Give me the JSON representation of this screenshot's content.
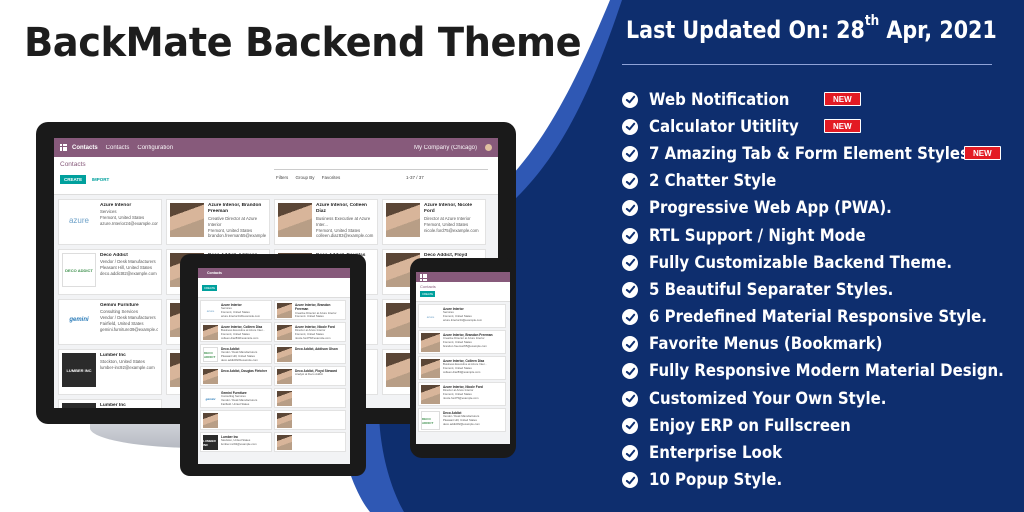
{
  "title": "BackMate Backend Theme",
  "updated": {
    "prefix": "Last Updated On: 28",
    "sup": "th",
    "suffix": " Apr, 2021"
  },
  "colors": {
    "navy": "#0e2e6e",
    "accent_blue": "#2f58b4",
    "badge_red": "#e31b23",
    "odoo_purple": "#875a7b",
    "teal": "#00a09d"
  },
  "features": [
    {
      "text": "Web Notification",
      "badge": "NEW"
    },
    {
      "text": "Calculator Utitlity",
      "badge": "NEW"
    },
    {
      "text": "7 Amazing Tab & Form Element Styles",
      "badge": "NEW"
    },
    {
      "text": "2 Chatter Style"
    },
    {
      "text": "Progressive Web App (PWA)."
    },
    {
      "text": "RTL Support / Night Mode"
    },
    {
      "text": "Fully Customizable Backend Theme."
    },
    {
      "text": "5 Beautiful Separater Styles."
    },
    {
      "text": "6 Predefined Material Responsive Style."
    },
    {
      "text": "Favorite Menus (Bookmark)"
    },
    {
      "text": "Fully Responsive Modern Material Design."
    },
    {
      "text": "Customized Your Own Style."
    },
    {
      "text": "Enjoy ERP on Fullscreen"
    },
    {
      "text": "Enterprise Look"
    },
    {
      "text": "10 Popup Style."
    }
  ],
  "app": {
    "name": "Contacts",
    "menu": [
      "Contacts",
      "Configuration"
    ],
    "company": "My Company (Chicago)",
    "breadcrumb": "Contacts",
    "create": "CREATE",
    "import": "IMPORT",
    "filters": "Filters",
    "group_by": "Group By",
    "favorites": "Favorites",
    "pager": "1-37 / 37",
    "cards": [
      {
        "logo": "azure",
        "logo_text": "azure",
        "name": "Azure Interior",
        "lines": [
          "Services",
          "Fremont, United States",
          "azure.Interior24@example.com"
        ]
      },
      {
        "logo": "photo",
        "logo_text": "",
        "name": "Azure Interior, Brandon Freeman",
        "lines": [
          "Creative Director at Azure Interior",
          "Fremont, United States",
          "brandon.freeman55@example.com"
        ]
      },
      {
        "logo": "photo",
        "logo_text": "",
        "name": "Azure Interior, Colleen Diaz",
        "lines": [
          "Business Executive at Azure Inter...",
          "Fremont, United States",
          "colleen.diaz83@example.com"
        ]
      },
      {
        "logo": "photo",
        "logo_text": "",
        "name": "Azure Interior, Nicole Ford",
        "lines": [
          "Director at Azure Interior",
          "Fremont, United States",
          "nicole.ford75@example.com"
        ]
      },
      {
        "logo": "deco",
        "logo_text": "DECO ADDICT",
        "name": "Deco Addict",
        "lines": [
          "Vendor / Desk Manufacturers",
          "Pleasant Hill, United States",
          "deco.addict82@example.com"
        ]
      },
      {
        "logo": "photo",
        "logo_text": "",
        "name": "Deco Addict, Addison Olson",
        "lines": [
          "",
          "",
          ""
        ]
      },
      {
        "logo": "photo",
        "logo_text": "",
        "name": "Deco Addict, Douglas Fletcher",
        "lines": [
          "",
          "",
          ""
        ]
      },
      {
        "logo": "photo",
        "logo_text": "",
        "name": "Deco Addict, Floyd Steward",
        "lines": [
          "Analyst at Deco Addict",
          "",
          ""
        ]
      },
      {
        "logo": "gemini",
        "logo_text": "gemini",
        "name": "Gemini Furniture",
        "lines": [
          "Consulting Services",
          "Vendor / Desk Manufacturers",
          "Fairfield, United States",
          "gemini.furniture39@example.c..."
        ]
      },
      {
        "logo": "photo",
        "logo_text": "",
        "name": "",
        "lines": []
      },
      {
        "logo": "photo",
        "logo_text": "",
        "name": "",
        "lines": []
      },
      {
        "logo": "photo",
        "logo_text": "",
        "name": "",
        "lines": []
      },
      {
        "logo": "lumber",
        "logo_text": "LUMBER INC",
        "name": "Lumber Inc",
        "lines": [
          "Stockton, United States",
          "lumber-inc92@example.com"
        ]
      },
      {
        "logo": "photo",
        "logo_text": "",
        "name": "",
        "lines": []
      },
      {
        "logo": "photo",
        "logo_text": "",
        "name": "",
        "lines": []
      },
      {
        "logo": "photo",
        "logo_text": "",
        "name": "",
        "lines": []
      },
      {
        "logo": "lumber",
        "logo_text": "LUMBER INC",
        "name": "Lumber Inc",
        "lines": [
          "Stockton, United States",
          "lumber-inc92@example.com"
        ]
      }
    ]
  }
}
